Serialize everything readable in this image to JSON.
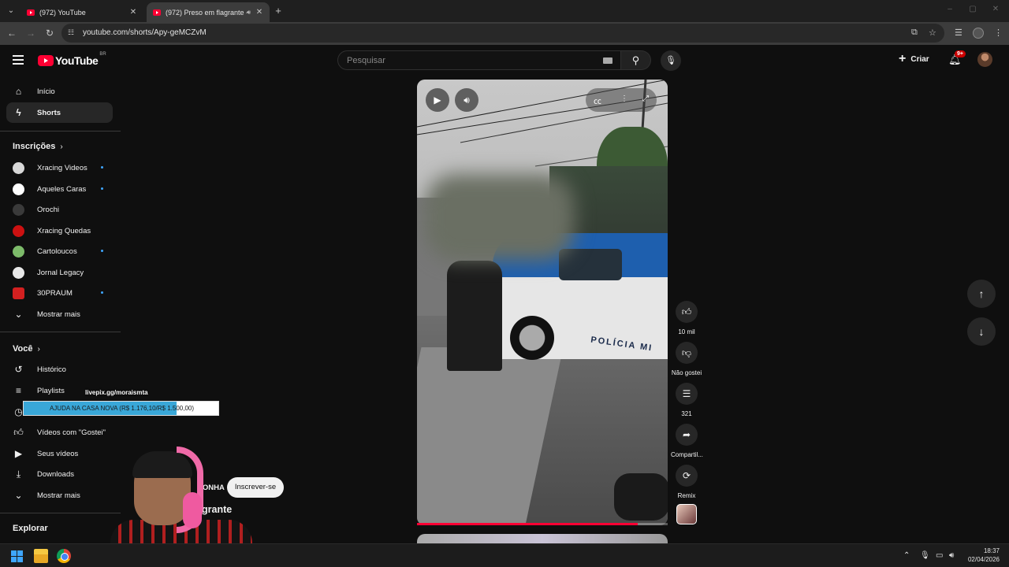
{
  "browser": {
    "tabs": [
      {
        "title": "(972) YouTube",
        "active": false
      },
      {
        "title": "(972) Preso em flagrante -",
        "active": true
      }
    ],
    "url": "youtube.com/shorts/Apy-geMCZvM"
  },
  "header": {
    "logo_text": "YouTube",
    "region": "BR",
    "search_placeholder": "Pesquisar",
    "create_label": "Criar",
    "notifications_badge": "9+"
  },
  "sidebar": {
    "main": [
      {
        "label": "Início",
        "icon": "home-icon"
      },
      {
        "label": "Shorts",
        "icon": "shorts-icon",
        "active": true
      }
    ],
    "subscriptions_title": "Inscrições",
    "subscriptions": [
      {
        "label": "Xracing Videos",
        "new": true,
        "color": "#d8d8d8"
      },
      {
        "label": "Aqueles Caras",
        "new": true,
        "color": "#ffffff"
      },
      {
        "label": "Orochi",
        "new": false,
        "color": "#3a3a3a"
      },
      {
        "label": "Xracing Quedas",
        "new": false,
        "color": "#cc1111"
      },
      {
        "label": "Cartoloucos",
        "new": true,
        "color": "#7dbb6a"
      },
      {
        "label": "Jornal Legacy",
        "new": false,
        "color": "#e8e8e8"
      },
      {
        "label": "30PRAUM",
        "new": true,
        "color": "#d32020"
      }
    ],
    "subs_more": "Mostrar mais",
    "you_title": "Você",
    "you": [
      {
        "label": "Histórico",
        "icon": "history-icon"
      },
      {
        "label": "Playlists",
        "icon": "playlists-icon"
      },
      {
        "label": "",
        "icon": "watch-later-icon"
      },
      {
        "label": "Vídeos com \"Gostei\"",
        "icon": "like-icon"
      },
      {
        "label": "Seus vídeos",
        "icon": "your-videos-icon"
      },
      {
        "label": "Downloads",
        "icon": "download-icon"
      }
    ],
    "you_more": "Mostrar mais",
    "explore_title": "Explorar"
  },
  "short": {
    "progress": 0.88,
    "actions": {
      "likes": "10 mil",
      "dislike": "Não gostei",
      "comments": "321",
      "share": "Compartil...",
      "remix": "Remix"
    },
    "channel_partial": "RONHA",
    "subscribe_label": "Inscrever-se",
    "title_partial": "grante",
    "scene_text": "POLÍCIA MI"
  },
  "overlay": {
    "donation_url": "livepix.gg/moraismta",
    "goal_text": "AJUDA NA CASA NOVA (R$ 1.176,10/R$ 1.500,00)",
    "goal_progress": 0.784
  },
  "taskbar": {
    "time": "18:37",
    "date": "02/04/2026"
  }
}
